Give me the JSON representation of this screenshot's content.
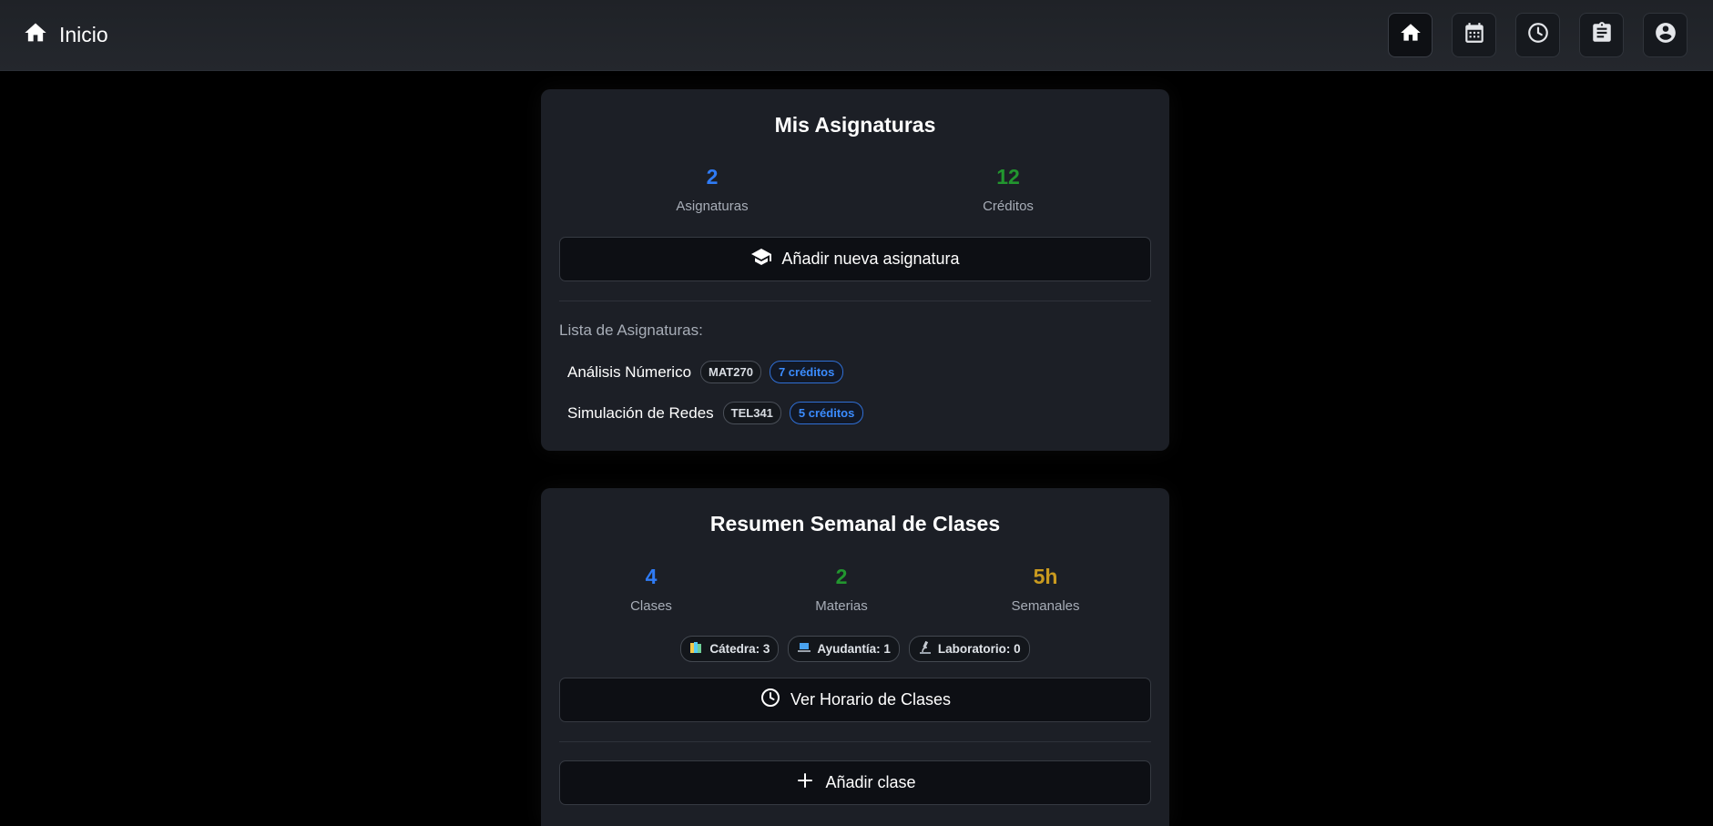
{
  "header": {
    "title": "Inicio",
    "nav": [
      {
        "name": "home",
        "icon": "home-icon",
        "active": true
      },
      {
        "name": "calendar",
        "icon": "calendar-icon",
        "active": false
      },
      {
        "name": "schedule",
        "icon": "clock-icon",
        "active": false
      },
      {
        "name": "tasks",
        "icon": "clipboard-icon",
        "active": false
      },
      {
        "name": "profile",
        "icon": "account-icon",
        "active": false
      }
    ]
  },
  "subjects_card": {
    "title": "Mis Asignaturas",
    "stats": [
      {
        "value": "2",
        "label": "Asignaturas",
        "color": "#2f7bf5"
      },
      {
        "value": "12",
        "label": "Créditos",
        "color": "#22962f"
      }
    ],
    "add_button": "Añadir nueva asignatura",
    "list_title": "Lista de Asignaturas:",
    "subjects": [
      {
        "name": "Análisis Númerico",
        "code": "MAT270",
        "credits": "7 créditos"
      },
      {
        "name": "Simulación de Redes",
        "code": "TEL341",
        "credits": "5 créditos"
      }
    ]
  },
  "weekly_card": {
    "title": "Resumen Semanal de Clases",
    "stats": [
      {
        "value": "4",
        "label": "Clases",
        "color": "#2f7bf5"
      },
      {
        "value": "2",
        "label": "Materias",
        "color": "#22962f"
      },
      {
        "value": "5h",
        "label": "Semanales",
        "color": "#c99a1f"
      }
    ],
    "chips": [
      {
        "label": "Cátedra: 3",
        "icon": "books-icon"
      },
      {
        "label": "Ayudantía: 1",
        "icon": "laptop-icon"
      },
      {
        "label": "Laboratorio: 0",
        "icon": "microscope-icon"
      }
    ],
    "schedule_button": "Ver Horario de Clases",
    "add_class_button": "Añadir clase"
  }
}
